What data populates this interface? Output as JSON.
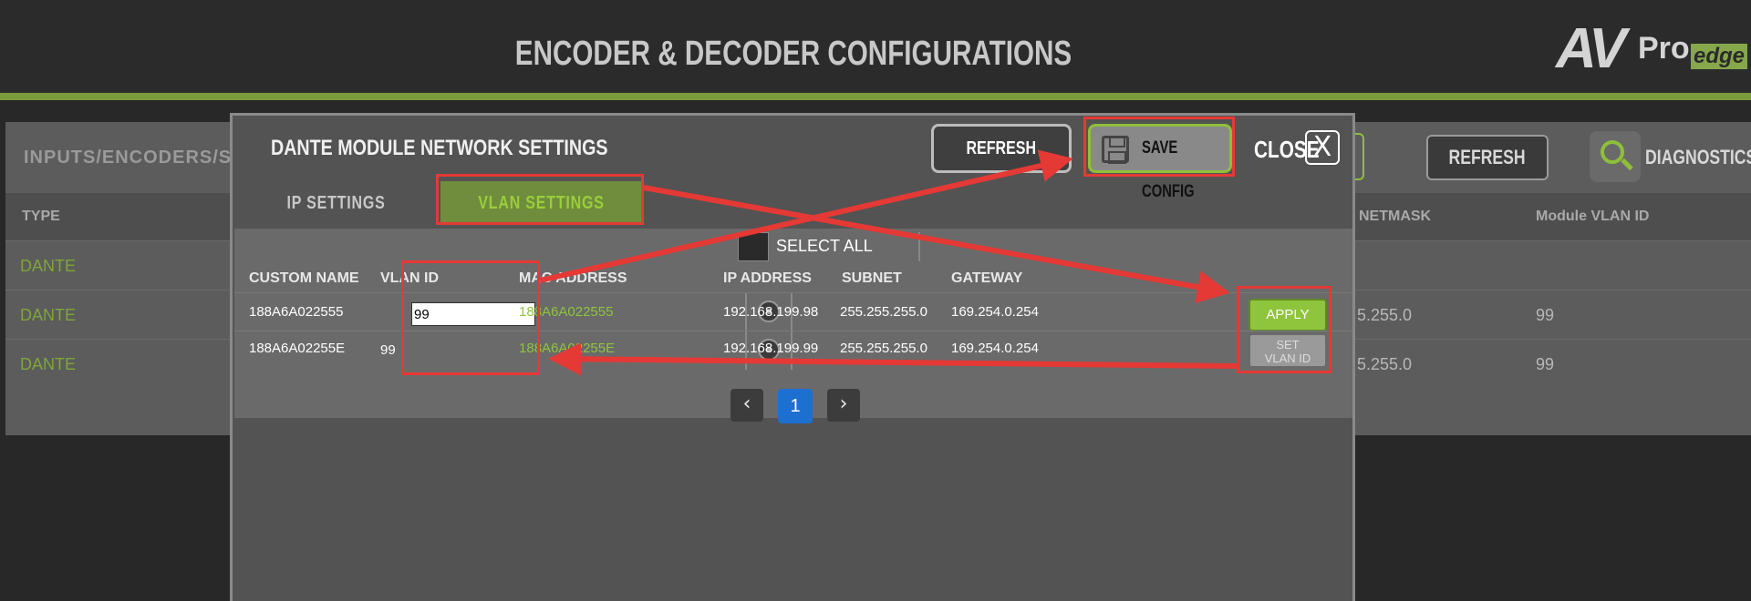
{
  "header": {
    "title": "ENCODER & DECODER CONFIGURATIONS"
  },
  "logo": {
    "av": "AV",
    "pro": "Pro",
    "edge": "edge"
  },
  "background": {
    "section_title": "INPUTS/ENCODERS/SOURC",
    "refresh_label": "REFRESH",
    "diagnostics_label": "DIAGNOSTICS",
    "columns": {
      "type": "TYPE",
      "netmask": "NETMASK",
      "module_vlan": "Module VLAN ID"
    },
    "rows": [
      {
        "type": "DANTE",
        "netmask": "",
        "vlan": ""
      },
      {
        "type": "DANTE",
        "netmask": "5.255.0",
        "vlan": "99"
      },
      {
        "type": "DANTE",
        "netmask": "5.255.0",
        "vlan": "99"
      }
    ]
  },
  "modal": {
    "title": "DANTE MODULE NETWORK SETTINGS",
    "refresh_label": "REFRESH",
    "save_label": "SAVE CONFIG",
    "close_label": "CLOSE",
    "close_glyph": "X",
    "tabs": {
      "ip": "IP SETTINGS",
      "vlan": "VLAN SETTINGS"
    },
    "select_all": "SELECT ALL",
    "columns": {
      "custom_name": "CUSTOM NAME",
      "vlan_id": "VLAN ID",
      "mac": "MAC ADDRESS",
      "ip": "IP ADDRESS",
      "subnet": "SUBNET",
      "gateway": "GATEWAY"
    },
    "rows": [
      {
        "name": "188A6A022555",
        "vlan": "99",
        "mac": "188A6A022555",
        "ip": "192.168.199.98",
        "subnet": "255.255.255.0",
        "gateway": "169.254.0.254",
        "action": "APPLY"
      },
      {
        "name": "188A6A02255E",
        "vlan": "99",
        "mac": "188A6A02255E",
        "ip": "192.168.199.99",
        "subnet": "255.255.255.0",
        "gateway": "169.254.0.254",
        "action_line1": "SET",
        "action_line2": "VLAN ID"
      }
    ],
    "pager": {
      "prev": "‹",
      "page": "1",
      "next": "›"
    }
  },
  "colors": {
    "accent_green": "#8fc43d",
    "annotation_red": "#e53935",
    "page_active": "#1d6fd0"
  }
}
